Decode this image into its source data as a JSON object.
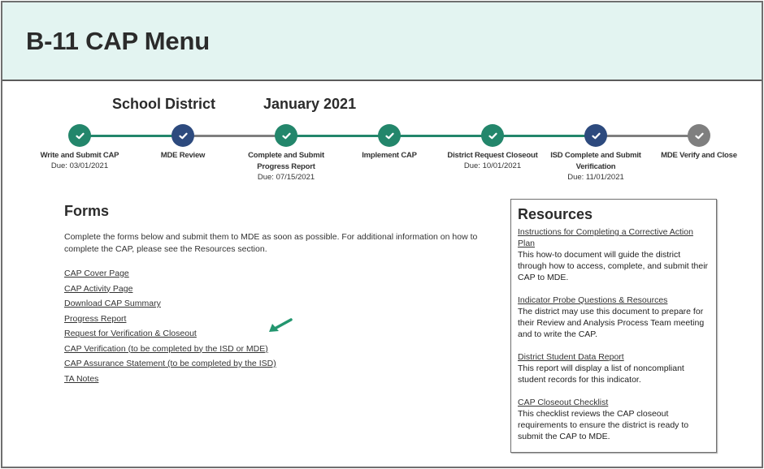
{
  "header": {
    "title": "B-11 CAP Menu"
  },
  "subheader": {
    "district": "School District",
    "date": "January 2021"
  },
  "colors": {
    "complete": "#23866b",
    "current": "#2d4a7e",
    "pending": "#7f7f7f",
    "header_bg": "#e3f4f1"
  },
  "timeline": {
    "steps": [
      {
        "label": "Write and Submit CAP",
        "due": "Due: 03/01/2021",
        "status": "complete"
      },
      {
        "label": "MDE Review",
        "due": "",
        "status": "current"
      },
      {
        "label": "Complete and Submit Progress Report",
        "due": "Due: 07/15/2021",
        "status": "complete"
      },
      {
        "label": "Implement CAP",
        "due": "",
        "status": "complete"
      },
      {
        "label": "District Request Closeout",
        "due": "Due: 10/01/2021",
        "status": "complete"
      },
      {
        "label": "ISD Complete and Submit Verification",
        "due": "Due: 11/01/2021",
        "status": "current"
      },
      {
        "label": "MDE Verify and Close",
        "due": "",
        "status": "pending"
      }
    ],
    "segments": [
      "complete",
      "pending",
      "complete",
      "complete",
      "complete",
      "pending"
    ]
  },
  "forms": {
    "title": "Forms",
    "intro": "Complete the forms below and submit them to MDE as soon as possible. For additional information on how to complete the CAP, please see the Resources section.",
    "links": [
      "CAP Cover Page",
      "CAP Activity Page",
      "Download CAP Summary",
      "Progress Report",
      "Request for Verification & Closeout",
      "CAP Verification (to be completed by the ISD or MDE)",
      "CAP Assurance Statement (to be completed by the ISD)",
      "TA Notes"
    ],
    "highlighted_link_index": 5
  },
  "resources": {
    "title": "Resources",
    "items": [
      {
        "link": "Instructions for Completing a Corrective Action Plan",
        "description": "This how-to document will guide the district through how to access, complete, and submit their CAP to MDE."
      },
      {
        "link": "Indicator Probe Questions & Resources",
        "description": "The district may use this document to prepare for their Review and Analysis Process Team meeting and to write the CAP."
      },
      {
        "link": "District Student Data Report",
        "description": "This report will display a list of noncompliant student records for this indicator."
      },
      {
        "link": "CAP Closeout Checklist",
        "description": "This checklist reviews the CAP closeout requirements to ensure the district is ready to submit the CAP to MDE."
      }
    ]
  }
}
